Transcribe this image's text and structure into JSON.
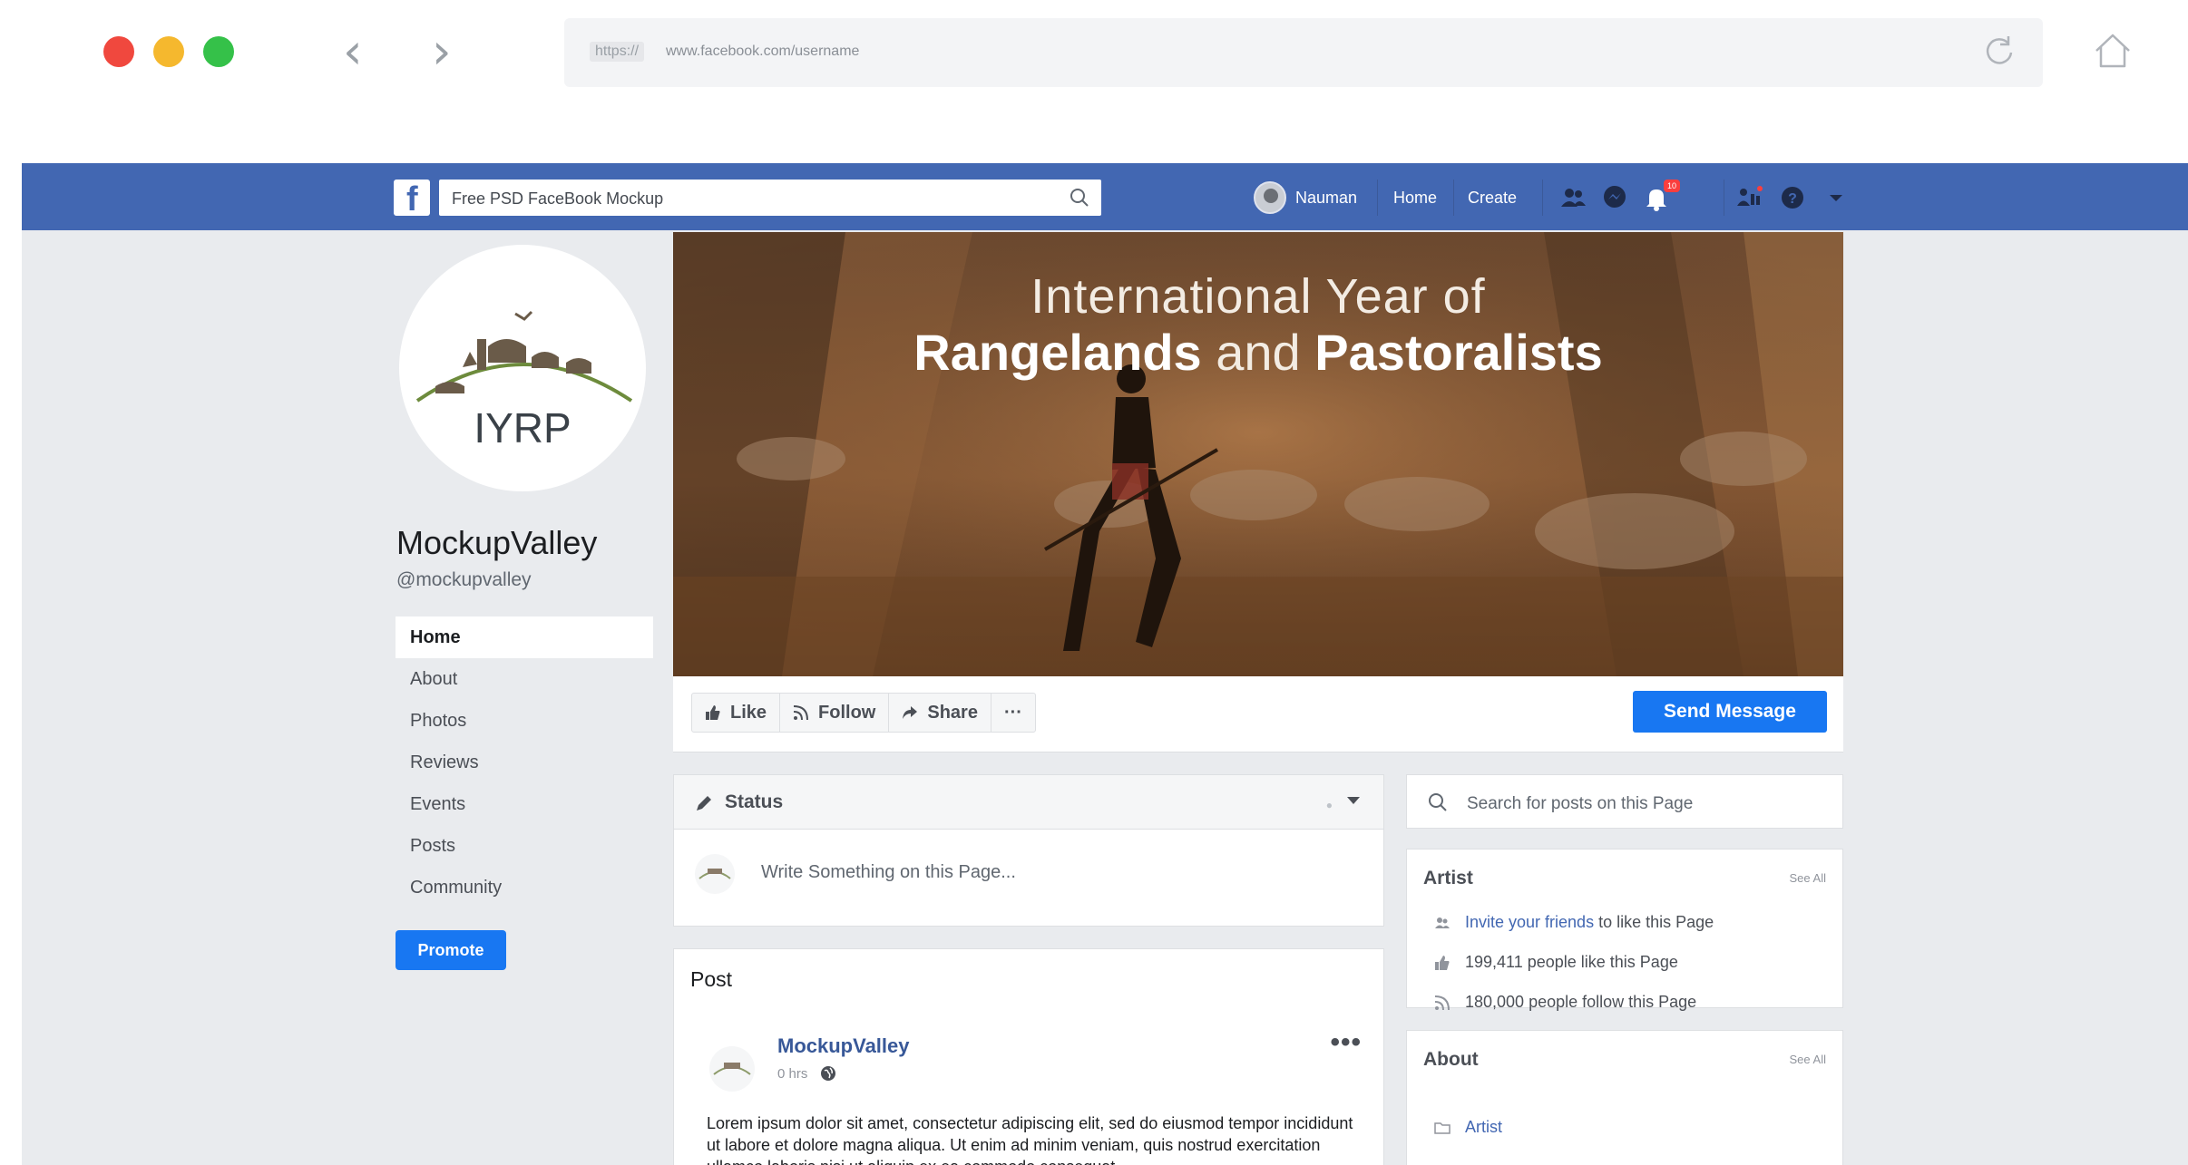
{
  "browser": {
    "url_scheme": "https://",
    "url": "www.facebook.com/username"
  },
  "topbar": {
    "logo": "f",
    "search_value": "Free PSD FaceBook Mockup",
    "user_name": "Nauman",
    "home_label": "Home",
    "create_label": "Create",
    "notification_count": "10"
  },
  "profile": {
    "logo_text": "IYRP",
    "name": "MockupValley",
    "handle": "@mockupvalley"
  },
  "left_nav": {
    "items": [
      {
        "label": "Home",
        "active": true
      },
      {
        "label": "About"
      },
      {
        "label": "Photos"
      },
      {
        "label": "Reviews"
      },
      {
        "label": "Events"
      },
      {
        "label": "Posts"
      },
      {
        "label": "Community"
      }
    ],
    "promote_label": "Promote"
  },
  "cover": {
    "line1": "International Year of",
    "line2_part1": "Rangelands",
    "line2_part2": "and",
    "line2_part3": "Pastoralists"
  },
  "actions": {
    "like": "Like",
    "follow": "Follow",
    "share": "Share",
    "more": "···",
    "send_message": "Send Message"
  },
  "status": {
    "label": "Status",
    "placeholder": "Write Something on this Page..."
  },
  "post": {
    "header": "Post",
    "author": "MockupValley",
    "time": "0 hrs",
    "more": "•••",
    "text": "Lorem ipsum dolor sit amet, consectetur adipiscing elit, sed do eiusmod tempor incididunt ut labore et dolore magna aliqua. Ut enim ad minim veniam, quis nostrud exercitation ullamco laboris nisi ut aliquip ex ea commodo consequat."
  },
  "right": {
    "search_placeholder": "Search for posts on this Page",
    "artist_title": "Artist",
    "see_all": "See All",
    "invite_link": "Invite your friends",
    "invite_rest": "to like this Page",
    "likes": "199,411 people like this Page",
    "follows": "180,000 people follow this Page",
    "about_title": "About",
    "about_see_all": "See All",
    "about_item": "Artist"
  },
  "colors": {
    "facebook_blue": "#4267b2",
    "button_blue": "#1877f2",
    "page_background": "#e9ebee"
  }
}
